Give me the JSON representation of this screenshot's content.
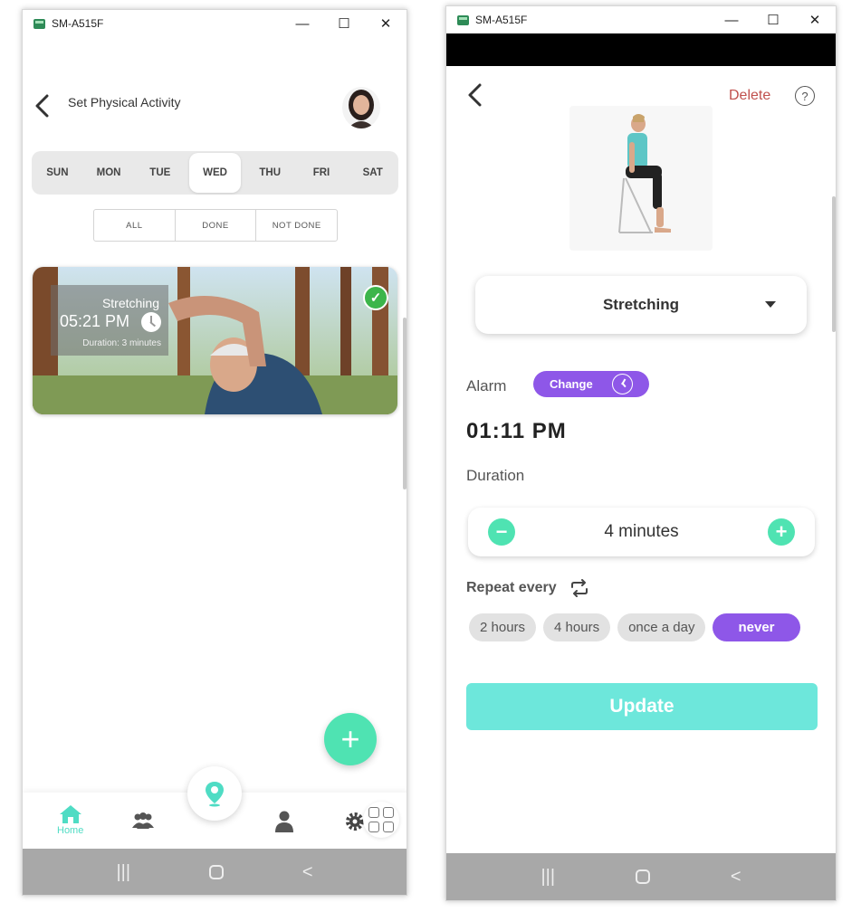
{
  "left_window": {
    "title": "SM-A515F",
    "controls": {
      "minimize": "—",
      "maximize": "☐",
      "close": "✕"
    },
    "header": {
      "back_icon": "chevron-left",
      "title": "Set Physical Activity"
    },
    "days": [
      "SUN",
      "MON",
      "TUE",
      "WED",
      "THU",
      "FRI",
      "SAT"
    ],
    "active_day": "WED",
    "filters": [
      "ALL",
      "DONE",
      "NOT DONE"
    ],
    "activity_card": {
      "name": "Stretching",
      "time": "05:21 PM",
      "duration": "Duration: 3 minutes",
      "done": true
    },
    "fab_label": "+",
    "bottom_nav": {
      "home_label": "Home",
      "accent": "#4fdcc4"
    },
    "system_nav": {
      "recents": "|||",
      "back": "<"
    }
  },
  "right_window": {
    "title": "SM-A515F",
    "controls": {
      "minimize": "—",
      "maximize": "☐",
      "close": "✕"
    },
    "delete_label": "Delete",
    "help_label": "?",
    "activity_select": "Stretching",
    "alarm_label": "Alarm",
    "change_label": "Change",
    "alarm_time": "01:11 PM",
    "duration_label": "Duration",
    "duration_value": "4 minutes",
    "minus_label": "−",
    "plus_label": "+",
    "repeat_label": "Repeat every",
    "repeat_options": [
      "2 hours",
      "4 hours",
      "once a day",
      "never"
    ],
    "repeat_selected": "never",
    "update_label": "Update",
    "system_nav": {
      "recents": "|||",
      "back": "<"
    },
    "colors": {
      "purple": "#8e57e8",
      "mint": "#4fe3b2",
      "update": "#6de7db",
      "delete": "#c0504d"
    }
  }
}
